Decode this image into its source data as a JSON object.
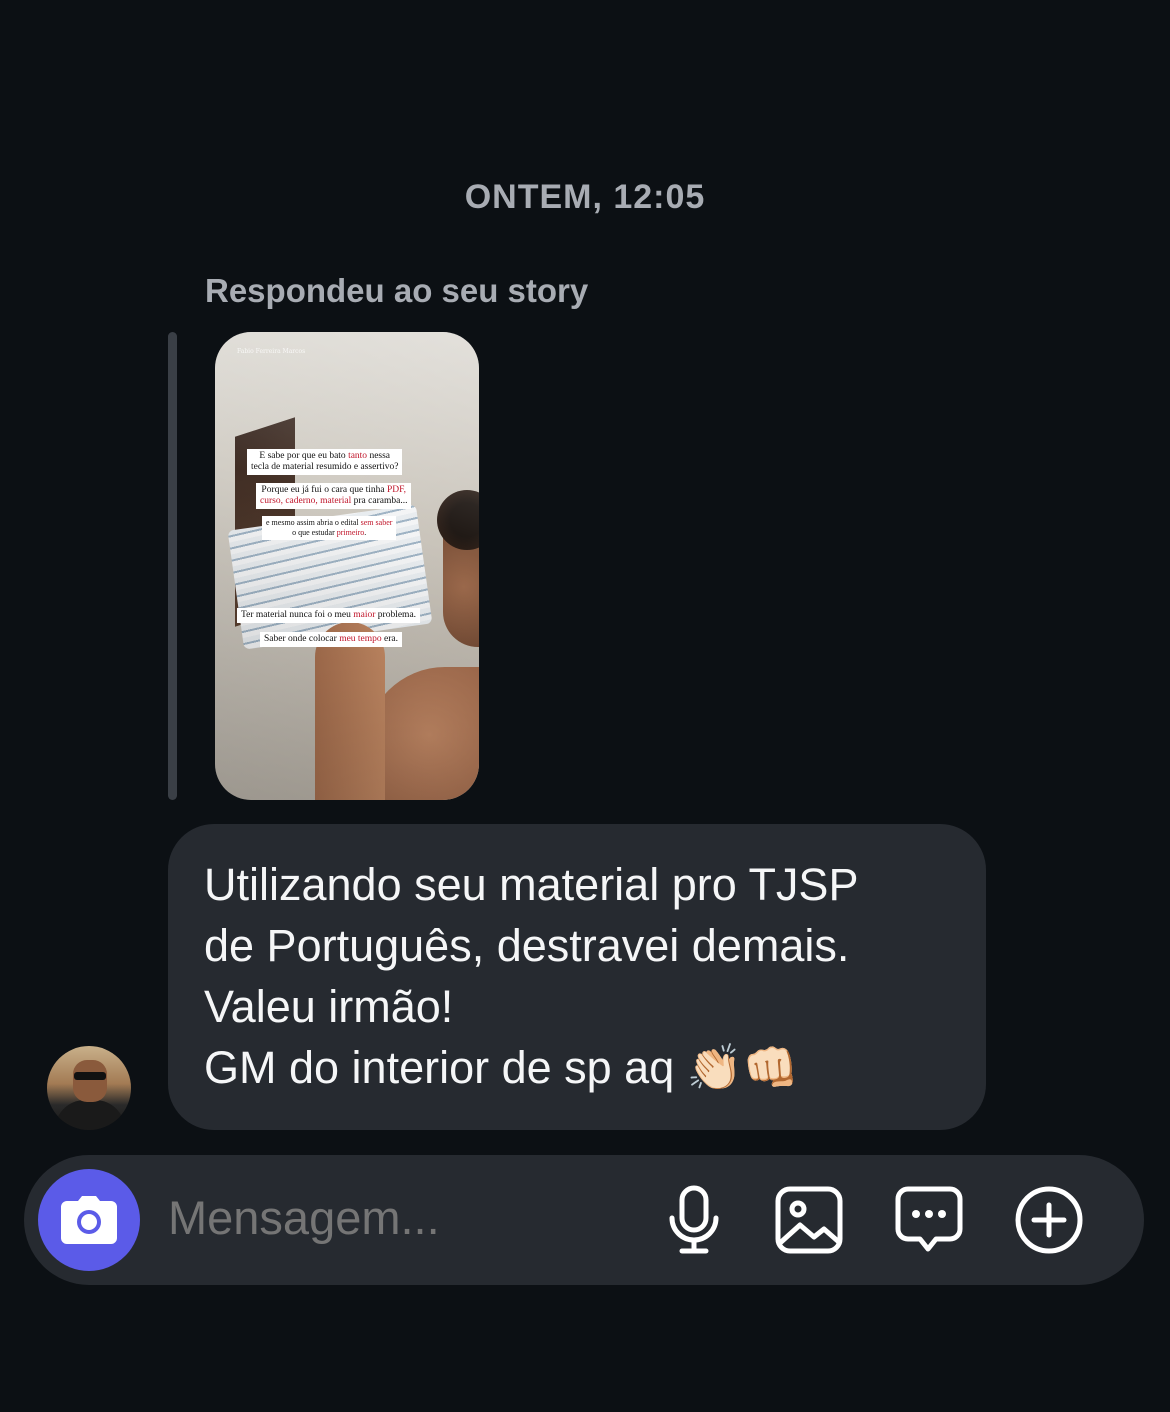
{
  "timestamp": "ONTEM, 12:05",
  "reply_label": "Respondeu ao seu story",
  "story": {
    "watermark": "Fabio Ferreira Marcos",
    "caption1_pre": "E sabe por que eu bato ",
    "caption1_red": "tanto",
    "caption1_post": " nessa",
    "caption1_line2": "tecla de material resumido e assertivo?",
    "caption2_pre": "Porque eu já fui o cara que tinha ",
    "caption2_red": "PDF,",
    "caption2_line2_red": "curso, caderno, material",
    "caption2_line2_post": " pra caramba...",
    "caption3_pre": "e mesmo assim abria o edital ",
    "caption3_red": "sem saber",
    "caption3_line2_pre": "o que estudar ",
    "caption3_line2_red": "primeiro",
    "caption3_line2_post": ".",
    "caption4_pre": "Ter material nunca foi o meu ",
    "caption4_red": "maior",
    "caption4_post": " problema.",
    "caption5_pre": "Saber onde colocar ",
    "caption5_red": "meu tempo",
    "caption5_post": " era."
  },
  "message": {
    "line1": "Utilizando seu material pro TJSP",
    "line2": "de Português, destravei demais.",
    "line3": "Valeu irmão!",
    "line4": "GM do interior de sp aq 👏🏻👊🏻"
  },
  "composer": {
    "placeholder": "Mensagem..."
  },
  "colors": {
    "accent": "#5b5be8",
    "bubble": "#262a30",
    "background": "#0c1014"
  },
  "icons": [
    "camera-icon",
    "microphone-icon",
    "image-icon",
    "sticker-message-icon",
    "plus-circle-icon"
  ]
}
